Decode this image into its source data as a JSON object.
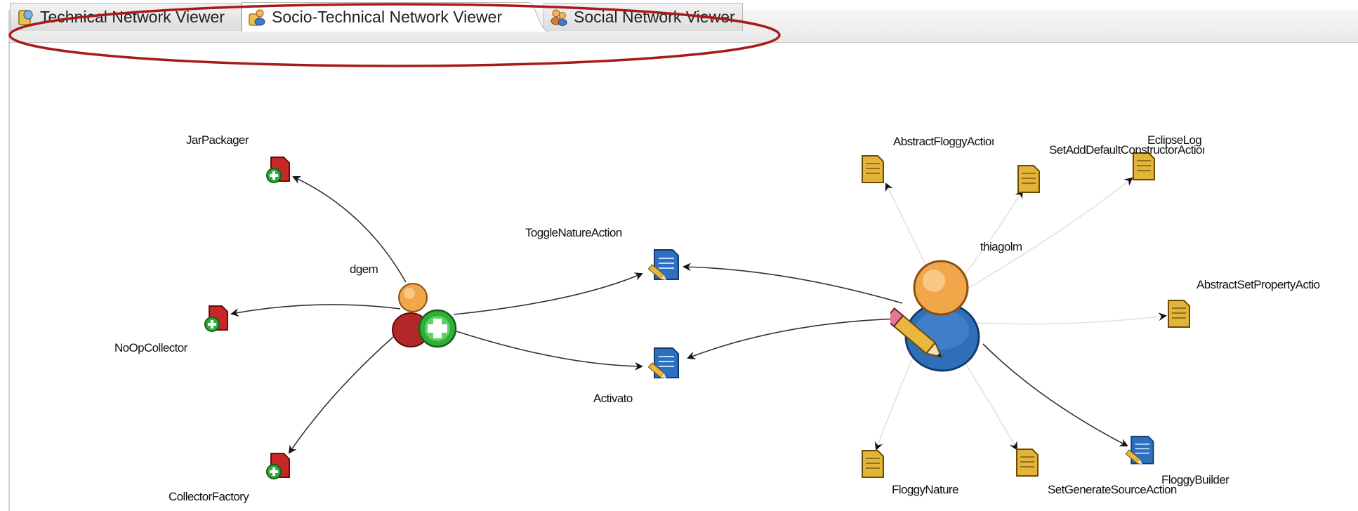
{
  "tabs": [
    {
      "label": "Technical Network Viewer",
      "icon": "technical-network-icon",
      "active": false
    },
    {
      "label": "Socio-Technical Network Viewer",
      "icon": "socio-technical-network-icon",
      "active": true
    },
    {
      "label": "Social Network Viewer",
      "icon": "social-network-icon",
      "active": false
    }
  ],
  "annotation_color": "#a81a1a",
  "graph": {
    "developers": [
      {
        "label": "dgem",
        "icon": "developer-add-icon"
      },
      {
        "label": "thiagolm",
        "icon": "developer-edit-icon"
      }
    ],
    "artifacts": [
      {
        "label": "JarPackager",
        "icon": "red-artifact-add-icon"
      },
      {
        "label": "NoOpCollector",
        "icon": "red-artifact-add-icon"
      },
      {
        "label": "CollectorFactory",
        "icon": "red-artifact-add-icon"
      },
      {
        "label": "ToggleNatureAction",
        "icon": "blue-document-edit-icon"
      },
      {
        "label": "Activato",
        "icon": "blue-document-edit-icon"
      },
      {
        "label": "AbstractFloggyActioı",
        "icon": "yellow-document-icon"
      },
      {
        "label": "SetAddDefaultConstructorActioı",
        "icon": "yellow-document-icon"
      },
      {
        "label": "EclipseLog",
        "icon": "yellow-document-icon"
      },
      {
        "label": "AbstractSetPropertyActio",
        "icon": "yellow-document-icon"
      },
      {
        "label": "FloggyNature",
        "icon": "yellow-document-icon"
      },
      {
        "label": "SetGenerateSourceAction",
        "icon": "yellow-document-icon"
      },
      {
        "label": "FloggyBuilder",
        "icon": "blue-document-edit-icon"
      }
    ]
  }
}
